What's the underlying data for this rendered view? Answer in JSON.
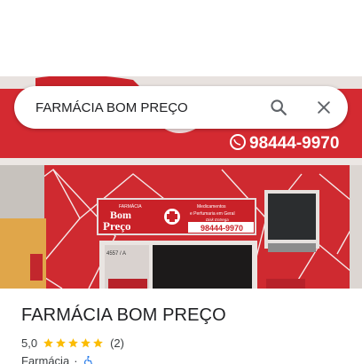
{
  "search": {
    "value": "FARMÁCIA BOM PREÇO",
    "placeholder": ""
  },
  "photo": {
    "phone": "98444-9970",
    "sign_phone": "98444-9970",
    "sign_top": "FARMÁCIA",
    "sign_brand_1": "Bom",
    "sign_brand_2": "Preço",
    "sign_line_1": "Medicamentos",
    "sign_line_2": "e Perfumaria em Geral",
    "sign_line_3": "Disk Entrega",
    "door_number": "4557 / A"
  },
  "place": {
    "title": "FARMÁCIA BOM PREÇO",
    "rating": "5,0",
    "stars": 5,
    "reviews": "(2)",
    "category": "Farmácia",
    "separator": "·"
  },
  "icons": {
    "search": "search-icon",
    "close": "close-icon",
    "star": "star-icon",
    "wheelchair": "wheelchair-icon",
    "whatsapp": "whatsapp-icon"
  },
  "colors": {
    "star": "#fbbc04",
    "accessibility": "#1a73e8",
    "storefront_red": "#d8282f"
  }
}
